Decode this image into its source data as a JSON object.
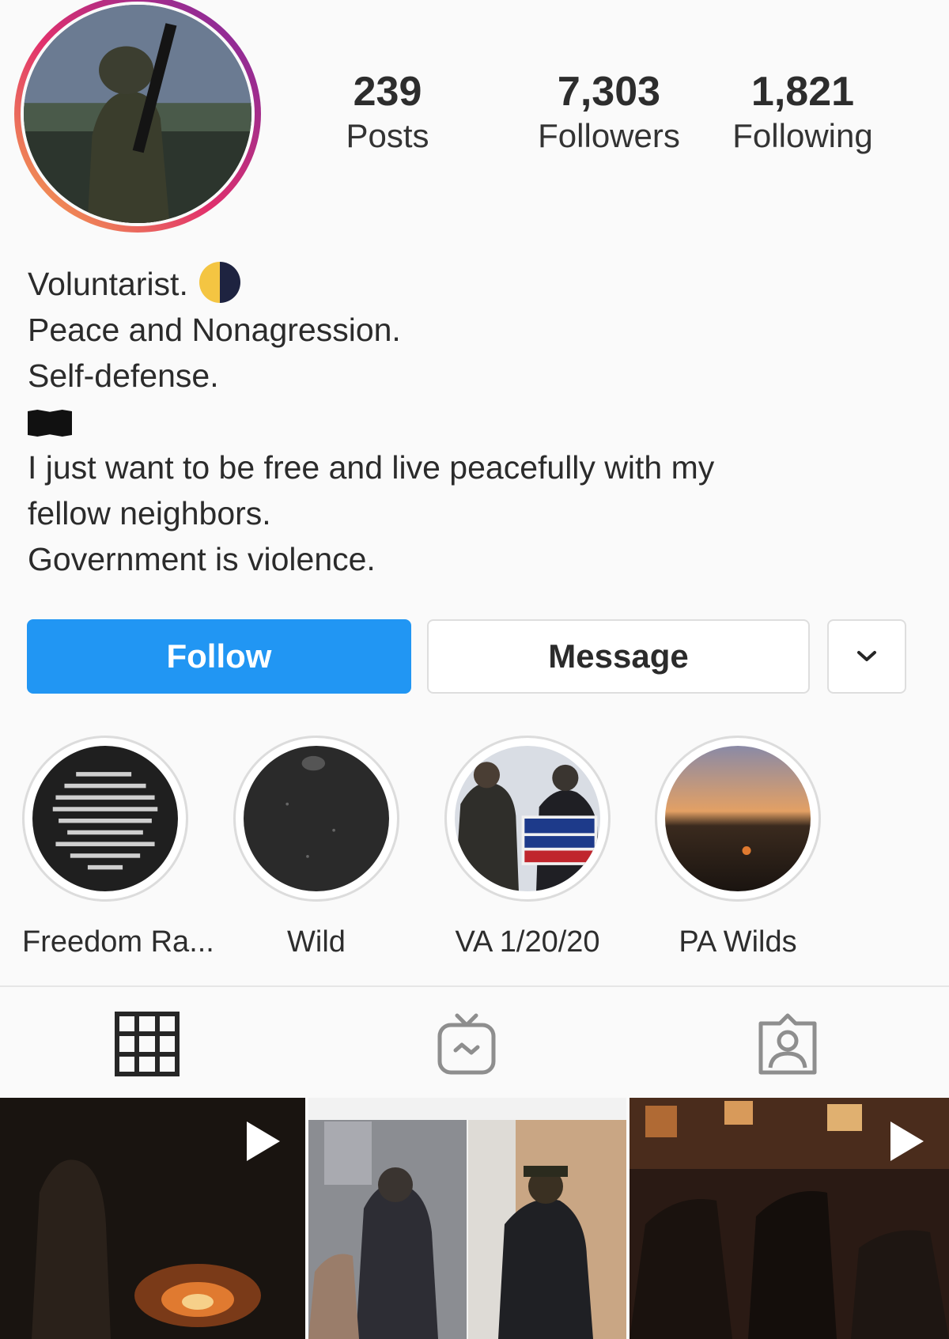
{
  "profile": {
    "avatar_alt": "profile-photo"
  },
  "stats": {
    "posts": {
      "value": "239",
      "label": "Posts"
    },
    "followers": {
      "value": "7,303",
      "label": "Followers"
    },
    "following": {
      "value": "1,821",
      "label": "Following"
    }
  },
  "bio": {
    "lines": [
      "Voluntarist.",
      "Peace and Nonagression.",
      "Self-defense.",
      "",
      "I just want to be free and live peacefully with my",
      "fellow neighbors.",
      "Government is violence."
    ],
    "icons": [
      "moon-icon",
      "black-flag-icon"
    ]
  },
  "actions": {
    "follow_label": "Follow",
    "message_label": "Message",
    "dropdown_icon": "chevron-down-icon",
    "follow_color": "#2196f3"
  },
  "highlights": [
    {
      "label": "Freedom Ra..."
    },
    {
      "label": "Wild"
    },
    {
      "label": "VA 1/20/20"
    },
    {
      "label": "PA Wilds"
    }
  ],
  "tabs": [
    {
      "icon": "grid-icon"
    },
    {
      "icon": "igtv-icon"
    },
    {
      "icon": "tagged-icon"
    }
  ],
  "posts": [
    {
      "type": "video",
      "icon": "play-icon"
    },
    {
      "type": "image"
    },
    {
      "type": "video",
      "icon": "play-icon"
    }
  ]
}
